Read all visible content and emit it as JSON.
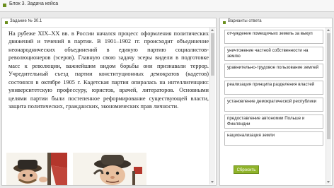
{
  "window": {
    "title": "Блок 3. Задача кейса"
  },
  "task_panel": {
    "title": "Задание № 30.1",
    "paragraph": "На рубеже XIX–XX вв. в России начался процесс оформления политических движений и течений в партии. В 1901–1902 гг. происходит объединение неонароднических объединений в единую партию социалистов-революционеров (эсеров). Главную свою задачу эсеры видели в подготовке масс к революции, важнейшим видом борьбы они признавали террор. Учредительный съезд партии конституционных демократов (кадетов) состоялся в октябре 1905 г. Кадетская партия опиралась на интеллигенцию: университетскую профессуру, юристов, врачей, литераторов. Основными целями партии были постепенное реформирование существующей власти, защита политических, гражданских, экономических прав личности.",
    "images": [
      "caricature-figure-1",
      "caricature-figure-2"
    ]
  },
  "answers_panel": {
    "title": "Варианты ответа",
    "options": [
      "отчуждение помещичьих земель за выкуп",
      "уничтожение частной собственности на землю",
      "уравнительно-трудовое пользование землей",
      "реализация принципа разделения властей",
      "установление демократической республики",
      "предоставление автономии Польше и Финляндии",
      "национализация земли"
    ],
    "reset_label": "Сбросить"
  },
  "colors": {
    "accent": "#8fb32a",
    "marker": "#6b8f1e"
  }
}
